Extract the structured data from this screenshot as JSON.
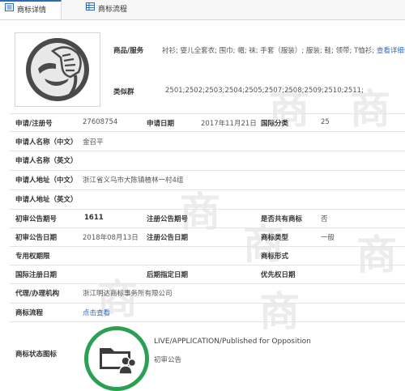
{
  "tabs": [
    {
      "label": "商标详情",
      "icon": "doc-list-icon"
    },
    {
      "label": "商标流程",
      "icon": "grid-table-icon"
    }
  ],
  "watermark_char": "商",
  "logo": {
    "icon": "facepalm-face-icon",
    "alt": "商标图样"
  },
  "goods": {
    "label": "商品/服务",
    "value": "衬衫; 婴儿全套衣; 围巾; 帽; 袜; 手套（服装）; 服装; 鞋; 领带; T恤衫;",
    "more_link": "查看详细信息"
  },
  "similar_group": {
    "label": "类似群",
    "value": "2501;2502;2503;2504;2505;2507;2508;2509;2510;2511;"
  },
  "fields": {
    "app_no_label": "申请/注册号",
    "app_no": "27608754",
    "app_date_label": "申请日期",
    "app_date": "2017年11月21日",
    "intl_class_label": "国际分类",
    "intl_class": "25",
    "applicant_cn_label": "申请人名称（中文）",
    "applicant_cn": "金召平",
    "applicant_en_label": "申请人名称（英文）",
    "applicant_en": "",
    "address_cn_label": "申请人地址（中文）",
    "address_cn": "浙江省义乌市大陈镇楂林一村4组",
    "address_en_label": "申请人地址（英文）",
    "address_en": "",
    "prelim_issue_label": "初审公告期号",
    "prelim_issue": "1611",
    "reg_issue_label": "注册公告期号",
    "reg_issue": "",
    "shared_label": "是否共有商标",
    "shared": "否",
    "prelim_date_label": "初审公告日期",
    "prelim_date": "2018年08月13日",
    "reg_date_label": "注册公告日期",
    "reg_date": "",
    "mark_type_label": "商标类型",
    "mark_type": "一般",
    "exclusive_label": "专用权期限",
    "exclusive": "",
    "mark_form_label": "商标形式",
    "mark_form": "",
    "intl_reg_date_label": "国际注册日期",
    "intl_reg_date": "",
    "later_date_label": "后期指定日期",
    "later_date": "",
    "priority_label": "优先权日期",
    "priority": "",
    "agency_label": "代理/办理机构",
    "agency": "浙江明达商标事务所有限公司",
    "process_label": "商标流程",
    "process_link": "点击查看",
    "status_icon_label": "商标状态图标"
  },
  "status": {
    "text": "LIVE/APPLICATION/Published for Opposition",
    "sub": "初审公告",
    "color": "#2aa052",
    "icon": "folder-people-icon"
  }
}
